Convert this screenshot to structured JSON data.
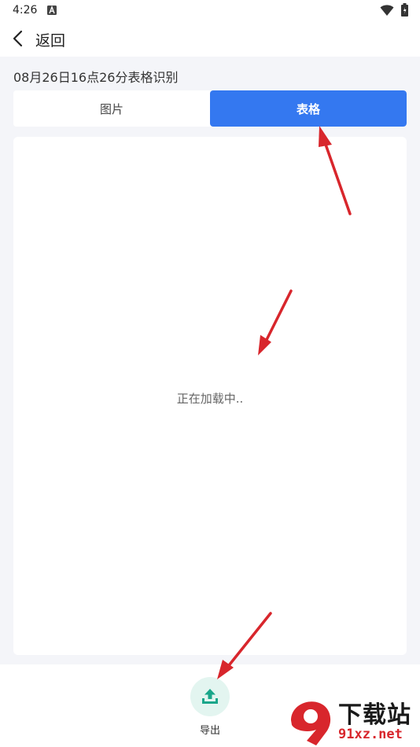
{
  "status_bar": {
    "time": "4:26"
  },
  "nav": {
    "back_label": "返回"
  },
  "document": {
    "title": "08月26日16点26分表格识别"
  },
  "tabs": [
    {
      "label": "图片",
      "active": false
    },
    {
      "label": "表格",
      "active": true
    }
  ],
  "content": {
    "loading_text": "正在加载中.."
  },
  "bottom": {
    "export_label": "导出"
  },
  "watermark": {
    "logo_text": "9",
    "title": "下载站",
    "url": "91xz.net"
  },
  "colors": {
    "accent": "#3478f0",
    "export_icon": "#1aa68a",
    "annotation_arrow": "#d8262c"
  }
}
